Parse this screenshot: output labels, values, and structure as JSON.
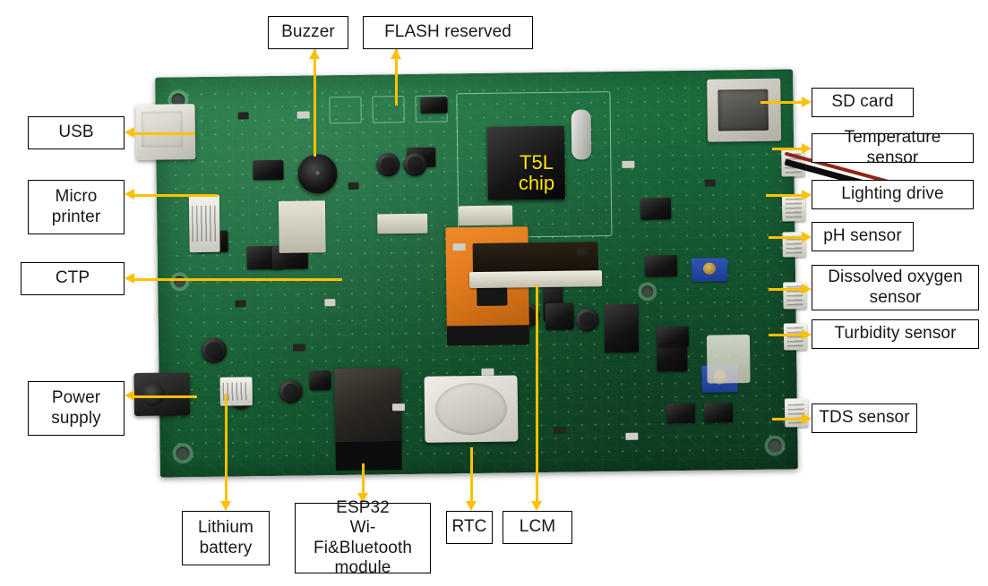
{
  "figure": {
    "title": "Annotated PCB board photograph with callout labels",
    "arrow_color": "#FFC000",
    "label_border_color": "#000000",
    "label_text_color": "#16181C",
    "board_color": "#19683A",
    "chip_label_color": "#FFE400"
  },
  "overlay": {
    "chip_label_line1": "T5L",
    "chip_label_line2": "chip"
  },
  "labels": {
    "buzzer": "Buzzer",
    "flash_reserved": "FLASH reserved",
    "sd_card": "SD card",
    "temperature_sensor": "Temperature sensor",
    "lighting_drive": "Lighting drive",
    "ph_sensor": "pH sensor",
    "dissolved_oxygen_sensor_line1": "Dissolved oxygen",
    "dissolved_oxygen_sensor_line2": "sensor",
    "turbidity_sensor": "Turbidity sensor",
    "tds_sensor": "TDS sensor",
    "usb": "USB",
    "micro_printer_line1": "Micro",
    "micro_printer_line2": "printer",
    "ctp": "CTP",
    "power_supply_line1": "Power",
    "power_supply_line2": "supply",
    "lithium_battery_line1": "Lithium",
    "lithium_battery_line2": "battery",
    "esp32_line1": "ESP32",
    "esp32_line2": "Wi-Fi&Bluetooth",
    "esp32_line3": "module",
    "rtc": "RTC",
    "lcm": "LCM"
  },
  "callouts": [
    {
      "id": "buzzer",
      "label": "Buzzer",
      "side": "top"
    },
    {
      "id": "flash-reserved",
      "label": "FLASH reserved",
      "side": "top"
    },
    {
      "id": "sd-card",
      "label": "SD card",
      "side": "right"
    },
    {
      "id": "temperature-sensor",
      "label": "Temperature sensor",
      "side": "right"
    },
    {
      "id": "lighting-drive",
      "label": "Lighting drive",
      "side": "right"
    },
    {
      "id": "ph-sensor",
      "label": "pH sensor",
      "side": "right"
    },
    {
      "id": "dissolved-oxygen",
      "label": "Dissolved oxygen sensor",
      "side": "right"
    },
    {
      "id": "turbidity-sensor",
      "label": "Turbidity sensor",
      "side": "right"
    },
    {
      "id": "tds-sensor",
      "label": "TDS sensor",
      "side": "right"
    },
    {
      "id": "usb",
      "label": "USB",
      "side": "left"
    },
    {
      "id": "micro-printer",
      "label": "Micro printer",
      "side": "left"
    },
    {
      "id": "ctp",
      "label": "CTP",
      "side": "left"
    },
    {
      "id": "power-supply",
      "label": "Power supply",
      "side": "left"
    },
    {
      "id": "lithium-battery",
      "label": "Lithium battery",
      "side": "bottom"
    },
    {
      "id": "esp32",
      "label": "ESP32 Wi-Fi&Bluetooth module",
      "side": "bottom"
    },
    {
      "id": "rtc",
      "label": "RTC",
      "side": "bottom"
    },
    {
      "id": "lcm",
      "label": "LCM",
      "side": "bottom"
    }
  ]
}
